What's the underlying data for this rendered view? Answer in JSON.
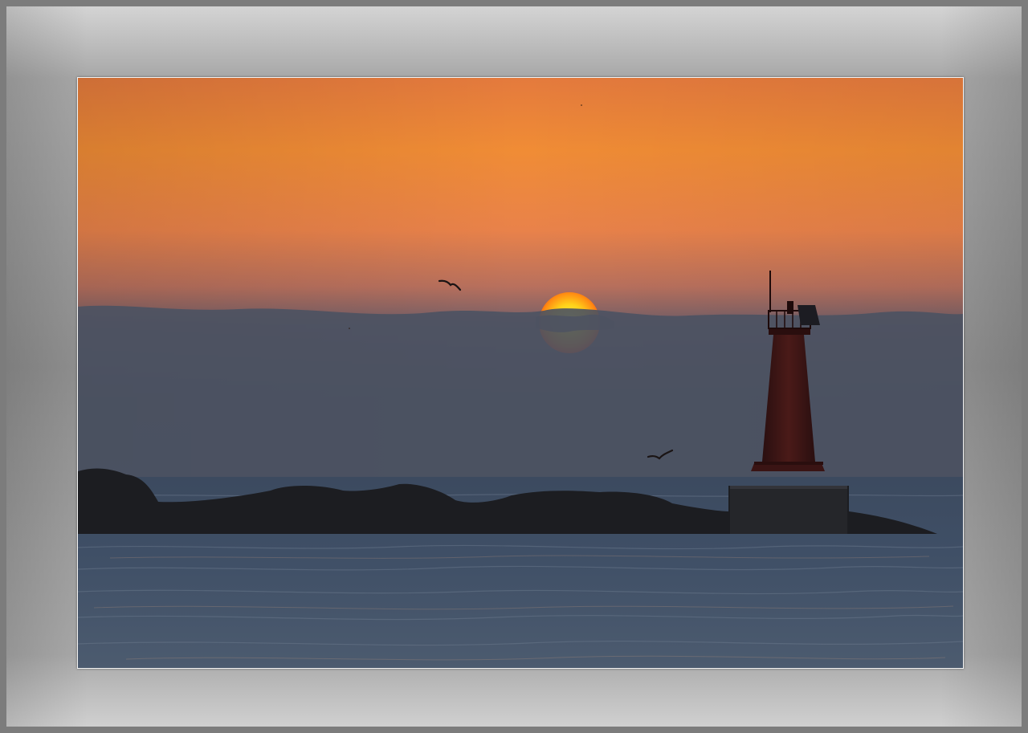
{
  "image": {
    "description_icon": "lighthouse-sunset-icon",
    "colors": {
      "sky_top": "#e77b3b",
      "sky_mid": "#f08a3a",
      "sky_low": "#b06a5a",
      "haze": "#4a4f5e",
      "sea": "#3d4d63",
      "sun_core": "#ffd21a",
      "sun_edge": "#ff5a14",
      "silhouette": "#1a1a1c",
      "lighthouse": "#3a1616"
    }
  }
}
